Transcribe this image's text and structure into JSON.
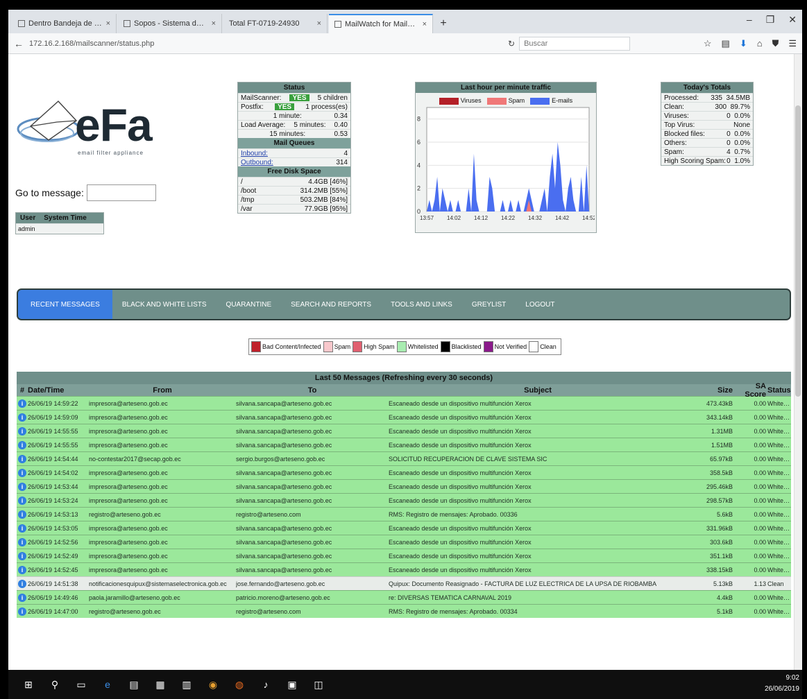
{
  "browser": {
    "tabs": [
      {
        "label": "Dentro Bandeja de entrad..."
      },
      {
        "label": "Sopos - Sistema de Ba..."
      },
      {
        "label": "Total FT-0719-24930"
      },
      {
        "label": "MailWatch for MailScann..."
      }
    ],
    "url": "172.16.2.168/mailscanner/status.php",
    "search_placeholder": "Buscar"
  },
  "logo": {
    "text": "eFa",
    "sub": "email filter appliance"
  },
  "goto": {
    "label": "Go to message:"
  },
  "user": {
    "col_user": "User",
    "col_time": "System Time",
    "value": "admin"
  },
  "status": {
    "title": "Status",
    "rows": [
      {
        "k": "MailScanner:",
        "v": "YES",
        "e": "5 children"
      },
      {
        "k": "Postfix:",
        "v": "YES",
        "e": "1 process(es)"
      },
      {
        "k": "",
        "v": "1 minute:",
        "e": "0.34"
      },
      {
        "k": "Load Average:",
        "v": "5 minutes:",
        "e": "0.40"
      },
      {
        "k": "",
        "v": "15 minutes:",
        "e": "0.53"
      }
    ],
    "queues_title": "Mail Queues",
    "queues": [
      {
        "k": "Inbound:",
        "v": "4"
      },
      {
        "k": "Outbound:",
        "v": "314"
      }
    ],
    "disk_title": "Free Disk Space",
    "disk": [
      {
        "k": "/",
        "v": "4.4GB [46%]"
      },
      {
        "k": "/boot",
        "v": "314.2MB [55%]"
      },
      {
        "k": "/tmp",
        "v": "503.2MB [84%]"
      },
      {
        "k": "/var",
        "v": "77.9GB [95%]"
      }
    ]
  },
  "traffic": {
    "title": "Last hour per minute traffic",
    "legend": [
      "Viruses",
      "Spam",
      "E-mails"
    ],
    "legend_colors": [
      "#b42028",
      "#f07878",
      "#4a6ef0"
    ],
    "y_ticks": [
      "8",
      "6",
      "4",
      "2",
      "0"
    ],
    "x_ticks": [
      "13:57",
      "14:02",
      "14:12",
      "14:22",
      "14:32",
      "14:42",
      "14:52"
    ]
  },
  "chart_data": {
    "type": "area",
    "title": "Last hour per minute traffic",
    "ylim": [
      0,
      9
    ],
    "x": [
      "13:57",
      "14:02",
      "14:12",
      "14:22",
      "14:32",
      "14:42",
      "14:52"
    ],
    "series": [
      {
        "name": "E-mails",
        "values": [
          0,
          1,
          0,
          1,
          3,
          0,
          2,
          1,
          0,
          1,
          0,
          0,
          1,
          0,
          0,
          0,
          2,
          0,
          5,
          1,
          0,
          0,
          0,
          0,
          3,
          2,
          0,
          0,
          0,
          1,
          0,
          0,
          1,
          0,
          0,
          1,
          0,
          0,
          1,
          2,
          1,
          0,
          0,
          0,
          1,
          2,
          0,
          3,
          5,
          2,
          6,
          4,
          1,
          0,
          2,
          3,
          1,
          0,
          0,
          3,
          0,
          4,
          0
        ]
      },
      {
        "name": "Spam",
        "values": [
          0,
          0,
          0,
          0,
          0,
          0,
          0,
          0,
          0,
          0,
          0,
          0,
          0,
          0,
          0,
          0,
          0,
          0,
          0,
          0,
          0,
          0,
          0,
          0,
          0,
          0,
          0,
          0,
          0,
          0,
          0,
          0,
          0,
          0,
          0,
          0,
          0,
          0,
          0,
          1,
          0,
          0,
          0,
          0,
          0,
          0,
          0,
          0,
          0,
          0,
          0,
          0,
          0,
          0,
          0,
          0,
          0,
          0,
          0,
          0,
          0,
          0,
          0
        ]
      },
      {
        "name": "Viruses",
        "values": [
          0,
          0,
          0,
          0,
          0,
          0,
          0,
          0,
          0,
          0,
          0,
          0,
          0,
          0,
          0,
          0,
          0,
          0,
          0,
          0,
          0,
          0,
          0,
          0,
          0,
          0,
          0,
          0,
          0,
          0,
          0,
          0,
          0,
          0,
          0,
          0,
          0,
          0,
          0,
          0,
          0,
          0,
          0,
          0,
          0,
          0,
          0,
          0,
          0,
          0,
          0,
          0,
          0,
          0,
          0,
          0,
          0,
          0,
          0,
          0,
          0,
          0,
          0
        ]
      }
    ]
  },
  "today": {
    "title": "Today's Totals",
    "rows": [
      {
        "k": "Processed:",
        "n": "335",
        "p": "34.5MB"
      },
      {
        "k": "Clean:",
        "n": "300",
        "p": "89.7%"
      },
      {
        "k": "Viruses:",
        "n": "0",
        "p": "0.0%"
      },
      {
        "k": "Top Virus:",
        "n": "",
        "p": "None"
      },
      {
        "k": "Blocked files:",
        "n": "0",
        "p": "0.0%"
      },
      {
        "k": "Others:",
        "n": "0",
        "p": "0.0%"
      },
      {
        "k": "Spam:",
        "n": "4",
        "p": "0.7%"
      },
      {
        "k": "High Scoring Spam:",
        "n": "0",
        "p": "1.0%"
      }
    ]
  },
  "menu": [
    {
      "label": "Recent Messages"
    },
    {
      "label": "Black and White Lists"
    },
    {
      "label": "Quarantine"
    },
    {
      "label": "Search and Reports"
    },
    {
      "label": "Tools and Links"
    },
    {
      "label": "Greylist"
    },
    {
      "label": "Logout"
    }
  ],
  "color_legend": [
    {
      "label": "Bad Content/Infected",
      "color": "#c0202a"
    },
    {
      "label": "Spam",
      "color": "#f8c8cc"
    },
    {
      "label": "High Spam",
      "color": "#e06070"
    },
    {
      "label": "Whitelisted",
      "color": "#a8ecb0"
    },
    {
      "label": "Blacklisted",
      "color": "#000000"
    },
    {
      "label": "Not Verified",
      "color": "#8a1a8a"
    },
    {
      "label": "Clean",
      "color": "#ffffff"
    }
  ],
  "messages": {
    "title": "Last 50 Messages (Refreshing every 30 seconds)",
    "headers": {
      "num": "#",
      "date": "Date/Time",
      "from": "From",
      "to": "To",
      "subject": "Subject",
      "size": "Size",
      "score": "SA Score",
      "status": "Status"
    },
    "rows": [
      {
        "date": "26/06/19 14:59:22",
        "from": "impresora@arteseno.gob.ec",
        "to": "silvana.sancapa@arteseno.gob.ec",
        "subject": "Escaneado desde un dispositivo multifunción Xerox",
        "size": "473.43kB",
        "score": "0.00",
        "status": "Whitelisted",
        "spam": false
      },
      {
        "date": "26/06/19 14:59:09",
        "from": "impresora@arteseno.gob.ec",
        "to": "silvana.sancapa@arteseno.gob.ec",
        "subject": "Escaneado desde un dispositivo multifunción Xerox",
        "size": "343.14kB",
        "score": "0.00",
        "status": "Whitelisted",
        "spam": false
      },
      {
        "date": "26/06/19 14:55:55",
        "from": "impresora@arteseno.gob.ec",
        "to": "silvana.sancapa@arteseno.gob.ec",
        "subject": "Escaneado desde un dispositivo multifunción Xerox",
        "size": "1.31MB",
        "score": "0.00",
        "status": "Whitelisted",
        "spam": false
      },
      {
        "date": "26/06/19 14:55:55",
        "from": "impresora@arteseno.gob.ec",
        "to": "silvana.sancapa@arteseno.gob.ec",
        "subject": "Escaneado desde un dispositivo multifunción Xerox",
        "size": "1.51MB",
        "score": "0.00",
        "status": "Whitelisted",
        "spam": false
      },
      {
        "date": "26/06/19 14:54:44",
        "from": "no-contestar2017@secap.gob.ec",
        "to": "sergio.burgos@arteseno.gob.ec",
        "subject": "SOLICITUD RECUPERACION DE CLAVE SISTEMA SIC",
        "size": "65.97kB",
        "score": "0.00",
        "status": "Whitelisted",
        "spam": false
      },
      {
        "date": "26/06/19 14:54:02",
        "from": "impresora@arteseno.gob.ec",
        "to": "silvana.sancapa@arteseno.gob.ec",
        "subject": "Escaneado desde un dispositivo multifunción Xerox",
        "size": "358.5kB",
        "score": "0.00",
        "status": "Whitelisted",
        "spam": false
      },
      {
        "date": "26/06/19 14:53:44",
        "from": "impresora@arteseno.gob.ec",
        "to": "silvana.sancapa@arteseno.gob.ec",
        "subject": "Escaneado desde un dispositivo multifunción Xerox",
        "size": "295.46kB",
        "score": "0.00",
        "status": "Whitelisted",
        "spam": false
      },
      {
        "date": "26/06/19 14:53:24",
        "from": "impresora@arteseno.gob.ec",
        "to": "silvana.sancapa@arteseno.gob.ec",
        "subject": "Escaneado desde un dispositivo multifunción Xerox",
        "size": "298.57kB",
        "score": "0.00",
        "status": "Whitelisted",
        "spam": false
      },
      {
        "date": "26/06/19 14:53:13",
        "from": "registro@arteseno.gob.ec",
        "to": "registro@arteseno.com",
        "subject": "RMS: Registro de mensajes: Aprobado. 00336",
        "size": "5.6kB",
        "score": "0.00",
        "status": "Whitelisted",
        "spam": false
      },
      {
        "date": "26/06/19 14:53:05",
        "from": "impresora@arteseno.gob.ec",
        "to": "silvana.sancapa@arteseno.gob.ec",
        "subject": "Escaneado desde un dispositivo multifunción Xerox",
        "size": "331.96kB",
        "score": "0.00",
        "status": "Whitelisted",
        "spam": false
      },
      {
        "date": "26/06/19 14:52:56",
        "from": "impresora@arteseno.gob.ec",
        "to": "silvana.sancapa@arteseno.gob.ec",
        "subject": "Escaneado desde un dispositivo multifunción Xerox",
        "size": "303.6kB",
        "score": "0.00",
        "status": "Whitelisted",
        "spam": false
      },
      {
        "date": "26/06/19 14:52:49",
        "from": "impresora@arteseno.gob.ec",
        "to": "silvana.sancapa@arteseno.gob.ec",
        "subject": "Escaneado desde un dispositivo multifunción Xerox",
        "size": "351.1kB",
        "score": "0.00",
        "status": "Whitelisted",
        "spam": false
      },
      {
        "date": "26/06/19 14:52:45",
        "from": "impresora@arteseno.gob.ec",
        "to": "silvana.sancapa@arteseno.gob.ec",
        "subject": "Escaneado desde un dispositivo multifunción Xerox",
        "size": "338.15kB",
        "score": "0.00",
        "status": "Whitelisted",
        "spam": false
      },
      {
        "date": "26/06/19 14:51:38",
        "from": "notificacionesquipux@sistemaselectronica.gob.ec",
        "to": "jose.fernando@arteseno.gob.ec",
        "subject": "Quipux: Documento Reasignado - FACTURA DE LUZ ELECTRICA DE LA UPSA DE RIOBAMBA",
        "size": "5.13kB",
        "score": "1.13",
        "status": "Clean",
        "spam": true
      },
      {
        "date": "26/06/19 14:49:46",
        "from": "paola.jaramillo@arteseno.gob.ec",
        "to": "patricio.moreno@arteseno.gob.ec",
        "subject": "re: DIVERSAS TEMATICA CARNAVAL 2019",
        "size": "4.4kB",
        "score": "0.00",
        "status": "Whitelisted",
        "spam": false
      },
      {
        "date": "26/06/19 14:47:00",
        "from": "registro@arteseno.gob.ec",
        "to": "registro@arteseno.com",
        "subject": "RMS: Registro de mensajes: Aprobado. 00334",
        "size": "5.1kB",
        "score": "0.00",
        "status": "Whitelisted",
        "spam": false
      }
    ]
  },
  "taskbar": {
    "time": "9:02",
    "date": "26/06/2019"
  }
}
